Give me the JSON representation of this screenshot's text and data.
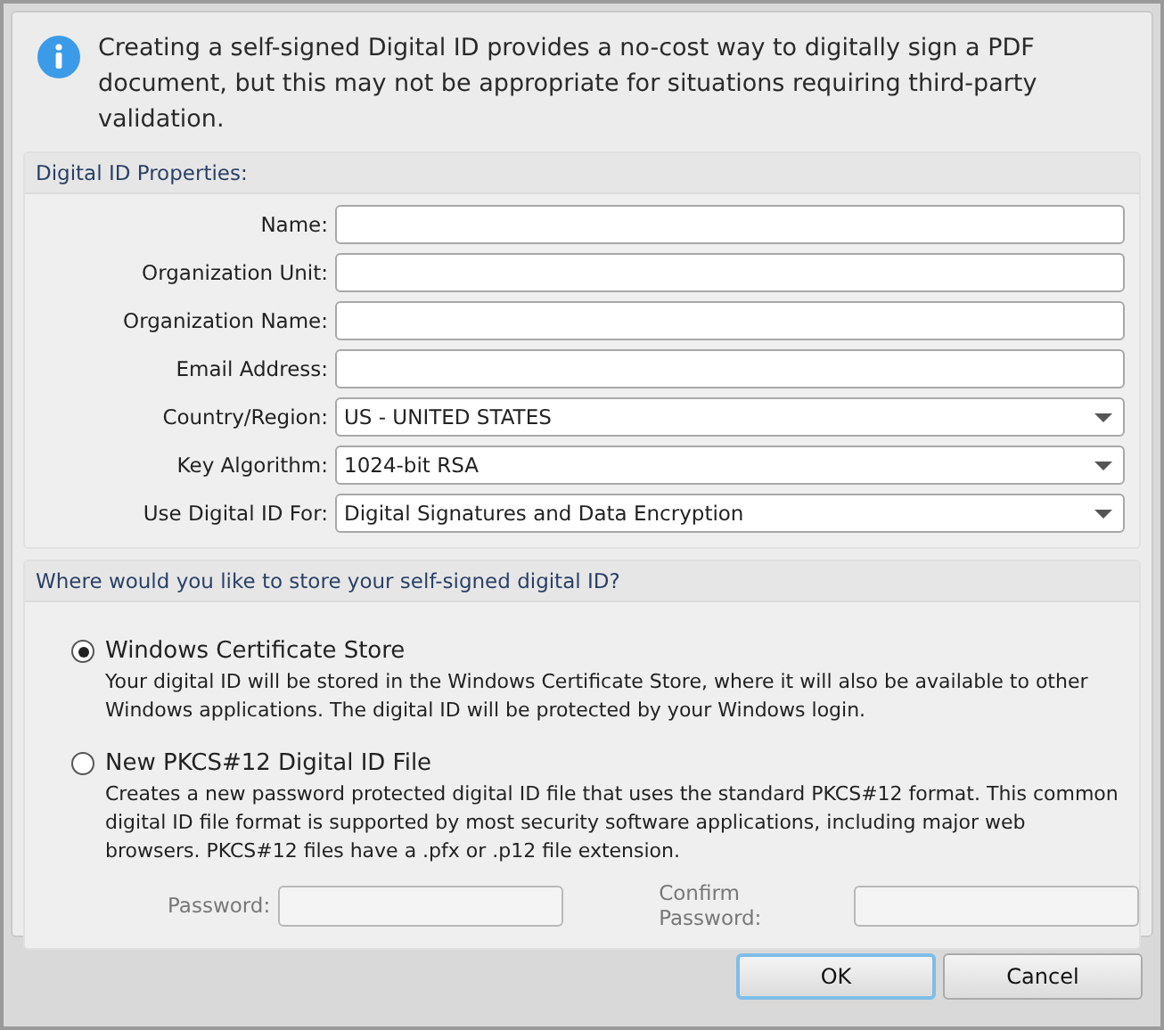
{
  "info": {
    "text": "Creating a self-signed Digital ID provides a no-cost way to digitally sign a PDF document, but this may not be appropriate for situations requiring third-party validation."
  },
  "properties": {
    "title": "Digital ID Properties:",
    "fields": [
      {
        "kind": "text",
        "label": "Name:"
      },
      {
        "kind": "text",
        "label": "Organization Unit:"
      },
      {
        "kind": "text",
        "label": "Organization Name:"
      },
      {
        "kind": "text",
        "label": "Email Address:"
      },
      {
        "kind": "dropdown",
        "label": "Country/Region:",
        "value": "US - UNITED STATES"
      },
      {
        "kind": "dropdown",
        "label": "Key Algorithm:",
        "value": "1024-bit RSA"
      },
      {
        "kind": "dropdown",
        "label": "Use Digital ID For:",
        "value": "Digital Signatures and Data Encryption"
      }
    ]
  },
  "storage": {
    "title": "Where would you like to store your self-signed digital ID?",
    "options": [
      {
        "label": "Windows Certificate Store",
        "selected": true,
        "description": "Your digital ID will be stored in the Windows Certificate Store, where it will also be available to other Windows applications. The digital ID will be protected by your Windows login."
      },
      {
        "label": "New PKCS#12 Digital ID File",
        "selected": false,
        "description": "Creates a new password protected digital ID file that uses the standard PKCS#12 format. This common digital ID file format is supported by most security software applications, including major web browsers. PKCS#12 files have a .pfx or .p12 file extension."
      }
    ],
    "passwords": [
      {
        "label": "Password:",
        "disabled": true
      },
      {
        "label": "Confirm Password:",
        "disabled": true
      }
    ]
  },
  "buttons": [
    {
      "label": "OK",
      "default": true
    },
    {
      "label": "Cancel",
      "default": false
    }
  ]
}
